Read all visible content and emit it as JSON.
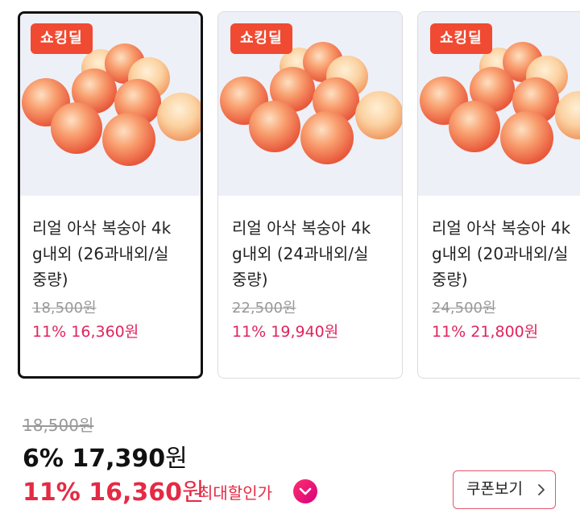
{
  "products": [
    {
      "badge": "쇼킹딜",
      "title_line1": "리얼 아삭 복숭아 4k",
      "title_line2": "g내외 (26과내외/실",
      "title_line3": "중량)",
      "original_price": "18,500원",
      "sale_price": "11% 16,360원",
      "selected": true
    },
    {
      "badge": "쇼킹딜",
      "title_line1": "리얼 아삭 복숭아 4k",
      "title_line2": "g내외 (24과내외/실",
      "title_line3": "중량)",
      "original_price": "22,500원",
      "sale_price": "11% 19,940원",
      "selected": false
    },
    {
      "badge": "쇼킹딜",
      "title_line1": "리얼 아삭 복숭아 4k",
      "title_line2": "g내외 (20과내외/실",
      "title_line3": "중량)",
      "original_price": "24,500원",
      "sale_price": "11% 21,800원",
      "selected": false
    }
  ],
  "price": {
    "original": "18,500원",
    "discount_amount": "6% 17,390",
    "discount_unit": "원",
    "max_amount": "11% 16,360",
    "max_unit": "원",
    "max_label": "최대할인가"
  },
  "coupon_button": "쿠폰보기",
  "colors": {
    "accent_red": "#e52a45",
    "badge_red": "#f04a32",
    "sale_pink": "#e0245e"
  },
  "icons": {
    "max_discount_toggle": "chevron-down-icon",
    "coupon_arrow": "chevron-right-icon"
  }
}
